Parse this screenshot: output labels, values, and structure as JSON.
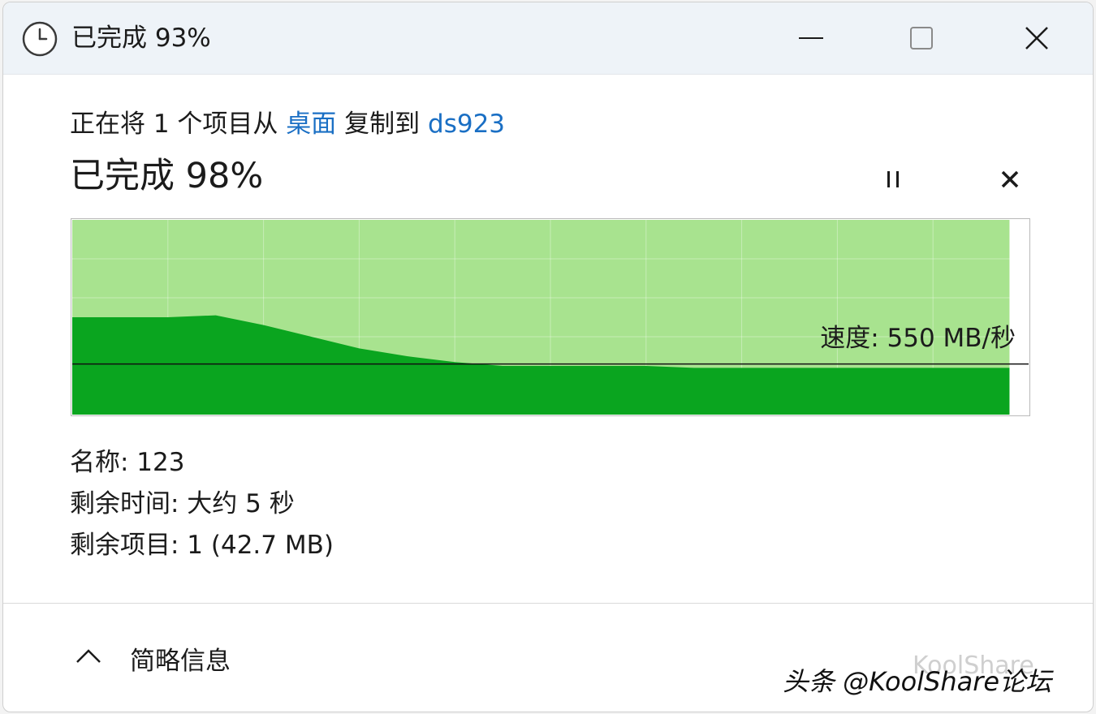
{
  "window": {
    "title": "已完成 93%",
    "icon": "clock-icon",
    "controls": {
      "minimize": "minimize-icon",
      "maximize": "maximize-icon",
      "close": "close-icon"
    }
  },
  "copy": {
    "prefix": "正在将 1 个项目从 ",
    "source": "桌面",
    "middle": " 复制到 ",
    "destination": "ds923"
  },
  "progress": {
    "title": "已完成 98%",
    "percent": 98,
    "pause_icon": "pause-icon",
    "cancel_icon": "close-icon"
  },
  "graph": {
    "speed_label": "速度: 550 MB/秒",
    "fill_color": "#a8e38f",
    "throughput_color": "#0aa51f"
  },
  "chart_data": {
    "type": "area",
    "x": [
      0,
      5,
      10,
      15,
      20,
      25,
      30,
      35,
      40,
      45,
      50,
      55,
      60,
      65,
      70,
      75,
      80,
      85,
      90,
      95,
      98
    ],
    "values": [
      0.5,
      0.5,
      0.5,
      0.51,
      0.46,
      0.4,
      0.34,
      0.3,
      0.27,
      0.25,
      0.25,
      0.25,
      0.25,
      0.24,
      0.24,
      0.24,
      0.24,
      0.24,
      0.24,
      0.24,
      0.24
    ],
    "current_speed": 0.26,
    "xlim": [
      0,
      100
    ],
    "ylim": [
      0,
      1
    ],
    "grid": true,
    "title": "",
    "xlabel": "",
    "ylabel": ""
  },
  "details": {
    "name": "名称: 123",
    "time_remaining": "剩余时间: 大约 5 秒",
    "items_remaining": "剩余项目: 1 (42.7 MB)"
  },
  "footer": {
    "toggle_label": "简略信息",
    "toggle_icon": "chevron-up-icon"
  },
  "watermark": {
    "text": "头条 @KoolShare论坛",
    "ghost_text": "KoolShare"
  }
}
